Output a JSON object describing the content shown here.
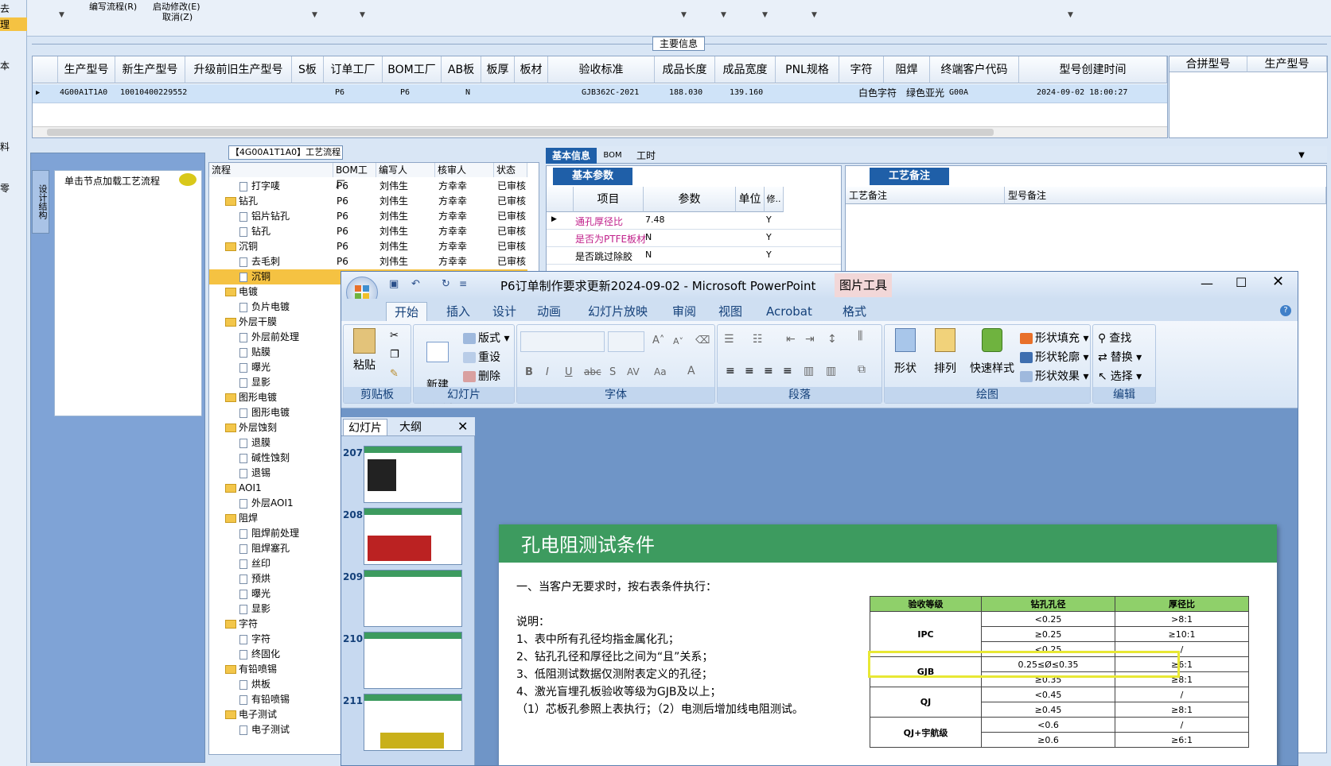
{
  "sidebar_clip": [
    "去",
    "理",
    "本",
    "料",
    "零"
  ],
  "top_menu": {
    "flow": "编写流程(R)",
    "start_change": "启动修改(E)",
    "cancel": "取消(Z)"
  },
  "main_info": {
    "title": "主要信息",
    "columns": [
      "生产型号",
      "新生产型号",
      "升级前旧生产型号",
      "S板",
      "订单工厂",
      "BOM工厂",
      "AB板",
      "板厚",
      "板材",
      "验收标准",
      "成品长度",
      "成品宽度",
      "PNL规格",
      "字符",
      "阻焊",
      "终端客户代码",
      "型号创建时间"
    ],
    "row": {
      "model": "4G00A1T1A0",
      "new_model": "10010400229552",
      "old_model": "",
      "s": "",
      "order_factory": "P6",
      "bom_factory": "P6",
      "ab": "N",
      "thick": "",
      "material": "",
      "standard": "GJB362C-2021",
      "length": "188.030",
      "width": "139.160",
      "pnl": "",
      "char": "白色字符",
      "solder": "绿色亚光",
      "customer": "G00A",
      "created": "2024-09-02 18:00:27"
    },
    "merge_cols": [
      "合拼型号",
      "生产型号"
    ]
  },
  "process": {
    "title": "【4G00A1T1A0】工艺流程",
    "hint": "单击节点加载工艺流程",
    "vtab": "设计结构",
    "headers": [
      "流程",
      "BOM工厂",
      "编写人",
      "核审人",
      "状态"
    ],
    "rows": [
      {
        "l": 2,
        "n": "打字唛",
        "f": "P6",
        "w": "刘伟生",
        "r": "方幸幸",
        "s": "已审核"
      },
      {
        "l": 1,
        "n": "钻孔",
        "f": "P6",
        "w": "刘伟生",
        "r": "方幸幸",
        "s": "已审核"
      },
      {
        "l": 2,
        "n": "铝片钻孔",
        "f": "P6",
        "w": "刘伟生",
        "r": "方幸幸",
        "s": "已审核"
      },
      {
        "l": 2,
        "n": "钻孔",
        "f": "P6",
        "w": "刘伟生",
        "r": "方幸幸",
        "s": "已审核"
      },
      {
        "l": 1,
        "n": "沉铜",
        "f": "P6",
        "w": "刘伟生",
        "r": "方幸幸",
        "s": "已审核"
      },
      {
        "l": 2,
        "n": "去毛刺",
        "f": "P6",
        "w": "刘伟生",
        "r": "方幸幸",
        "s": "已审核"
      },
      {
        "l": 2,
        "n": "沉铜",
        "f": "",
        "w": "",
        "r": "",
        "s": ""
      },
      {
        "l": 1,
        "n": "电镀",
        "f": "",
        "w": "",
        "r": "",
        "s": ""
      },
      {
        "l": 2,
        "n": "负片电镀",
        "f": "",
        "w": "",
        "r": "",
        "s": ""
      },
      {
        "l": 1,
        "n": "外层干膜",
        "f": "",
        "w": "",
        "r": "",
        "s": ""
      },
      {
        "l": 2,
        "n": "外层前处理",
        "f": "",
        "w": "",
        "r": "",
        "s": ""
      },
      {
        "l": 2,
        "n": "贴膜",
        "f": "",
        "w": "",
        "r": "",
        "s": ""
      },
      {
        "l": 2,
        "n": "曝光",
        "f": "",
        "w": "",
        "r": "",
        "s": ""
      },
      {
        "l": 2,
        "n": "显影",
        "f": "",
        "w": "",
        "r": "",
        "s": ""
      },
      {
        "l": 1,
        "n": "图形电镀",
        "f": "",
        "w": "",
        "r": "",
        "s": ""
      },
      {
        "l": 2,
        "n": "图形电镀",
        "f": "",
        "w": "",
        "r": "",
        "s": ""
      },
      {
        "l": 1,
        "n": "外层蚀刻",
        "f": "",
        "w": "",
        "r": "",
        "s": ""
      },
      {
        "l": 2,
        "n": "退膜",
        "f": "",
        "w": "",
        "r": "",
        "s": ""
      },
      {
        "l": 2,
        "n": "碱性蚀刻",
        "f": "",
        "w": "",
        "r": "",
        "s": ""
      },
      {
        "l": 2,
        "n": "退锡",
        "f": "",
        "w": "",
        "r": "",
        "s": ""
      },
      {
        "l": 1,
        "n": "AOI1",
        "f": "",
        "w": "",
        "r": "",
        "s": ""
      },
      {
        "l": 2,
        "n": "外层AOI1",
        "f": "",
        "w": "",
        "r": "",
        "s": ""
      },
      {
        "l": 1,
        "n": "阻焊",
        "f": "",
        "w": "",
        "r": "",
        "s": ""
      },
      {
        "l": 2,
        "n": "阻焊前处理",
        "f": "",
        "w": "",
        "r": "",
        "s": ""
      },
      {
        "l": 2,
        "n": "阻焊塞孔",
        "f": "",
        "w": "",
        "r": "",
        "s": ""
      },
      {
        "l": 2,
        "n": "丝印",
        "f": "",
        "w": "",
        "r": "",
        "s": ""
      },
      {
        "l": 2,
        "n": "预烘",
        "f": "",
        "w": "",
        "r": "",
        "s": ""
      },
      {
        "l": 2,
        "n": "曝光",
        "f": "",
        "w": "",
        "r": "",
        "s": ""
      },
      {
        "l": 2,
        "n": "显影",
        "f": "",
        "w": "",
        "r": "",
        "s": ""
      },
      {
        "l": 1,
        "n": "字符",
        "f": "",
        "w": "",
        "r": "",
        "s": ""
      },
      {
        "l": 2,
        "n": "字符",
        "f": "",
        "w": "",
        "r": "",
        "s": ""
      },
      {
        "l": 2,
        "n": "终固化",
        "f": "",
        "w": "",
        "r": "",
        "s": ""
      },
      {
        "l": 1,
        "n": "有铅喷锡",
        "f": "",
        "w": "",
        "r": "",
        "s": ""
      },
      {
        "l": 2,
        "n": "烘板",
        "f": "",
        "w": "",
        "r": "",
        "s": ""
      },
      {
        "l": 2,
        "n": "有铅喷锡",
        "f": "",
        "w": "",
        "r": "",
        "s": ""
      },
      {
        "l": 1,
        "n": "电子测试",
        "f": "",
        "w": "",
        "r": "",
        "s": ""
      },
      {
        "l": 2,
        "n": "电子测试",
        "f": "",
        "w": "",
        "r": "",
        "s": ""
      }
    ]
  },
  "info_tabs": [
    "基本信息",
    "BOM",
    "工时"
  ],
  "basic": {
    "title": "基本参数",
    "headers": [
      "项目",
      "参数",
      "单位",
      "修.."
    ],
    "rows": [
      {
        "k": "通孔厚径比",
        "v": "7.48",
        "u": "",
        "m": "Y"
      },
      {
        "k": "是否为PTFE板材",
        "v": "N",
        "u": "",
        "m": "Y"
      },
      {
        "k": "是否跳过除胶",
        "v": "N",
        "u": "",
        "m": "Y"
      }
    ]
  },
  "notes": {
    "title": "工艺备注",
    "c1": "工艺备注",
    "c2": "型号备注"
  },
  "ppt": {
    "title": "P6订单制作要求更新2024-09-02 - Microsoft PowerPoint",
    "context_tab": "图片工具",
    "tabs": [
      "开始",
      "插入",
      "设计",
      "动画",
      "幻灯片放映",
      "审阅",
      "视图",
      "Acrobat",
      "格式"
    ],
    "groups": {
      "clipboard": "剪贴板",
      "slides": "幻灯片",
      "font": "字体",
      "paragraph": "段落",
      "drawing": "绘图",
      "edit": "编辑"
    },
    "btn": {
      "paste": "粘贴",
      "new_slide": "新建\n幻灯片",
      "layout": "版式",
      "reset": "重设",
      "delete": "删除",
      "shape": "形状",
      "arrange": "排列",
      "quick_style": "快速样式",
      "fill": "形状填充",
      "outline": "形状轮廓",
      "effect": "形状效果",
      "find": "查找",
      "replace": "替换",
      "select": "选择"
    },
    "pane_tabs": [
      "幻灯片",
      "大纲"
    ],
    "thumbs": [
      "207",
      "208",
      "209",
      "210",
      "211"
    ],
    "slide": {
      "title": "孔电阻测试条件",
      "lines": [
        "一、当客户无要求时，按右表条件执行：",
        "说明：",
        "1、表中所有孔径均指金属化孔；",
        "2、钻孔孔径和厚径比之间为“且”关系；",
        "3、低阻测试数据仅测附表定义的孔径；",
        "4、激光盲埋孔板验收等级为GJB及以上；",
        "（1）芯板孔参照上表执行；（2）电测后增加线电阻测试。"
      ],
      "table_head": [
        "验收等级",
        "钻孔孔径",
        "厚径比"
      ],
      "table": [
        [
          "IPC",
          "<0.25",
          ">8:1"
        ],
        [
          "",
          "≥0.25",
          "≥10:1"
        ],
        [
          "",
          "<0.25",
          "/"
        ],
        [
          "GJB",
          "0.25≤Ø≤0.35",
          "≥6:1"
        ],
        [
          "",
          "≥0.35",
          "≥8:1"
        ],
        [
          "QJ",
          "<0.45",
          "/"
        ],
        [
          "",
          "≥0.45",
          "≥8:1"
        ],
        [
          "QJ+宇航级",
          "<0.6",
          "/"
        ],
        [
          "",
          "≥0.6",
          "≥6:1"
        ]
      ]
    }
  }
}
